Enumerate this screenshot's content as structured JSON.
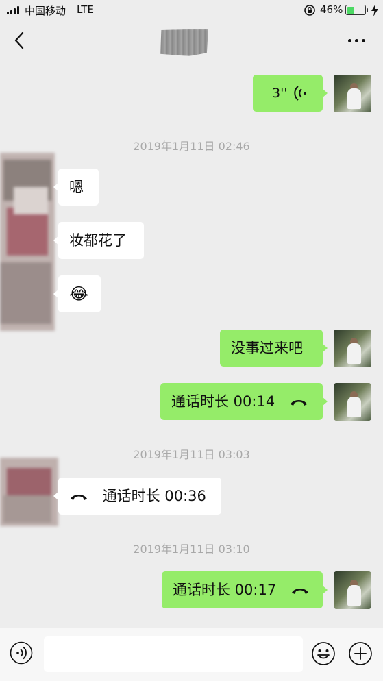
{
  "status_bar": {
    "carrier": "中国移动",
    "network": "LTE",
    "battery_percent": "46%",
    "battery_level": 0.46,
    "orientation_lock_icon": "orientation-lock-icon",
    "charging_icon": "charging-bolt-icon"
  },
  "nav": {
    "back_icon": "chevron-left-icon",
    "more_icon": "more-dots-icon"
  },
  "messages": [
    {
      "type": "voice",
      "direction": "out",
      "duration": "3''"
    },
    {
      "type": "timestamp",
      "text": "2019年1月11日 02:46"
    },
    {
      "type": "text",
      "direction": "in",
      "text": "嗯"
    },
    {
      "type": "text",
      "direction": "in",
      "text": "妆都花了"
    },
    {
      "type": "emoji",
      "direction": "in",
      "text": "😂"
    },
    {
      "type": "text",
      "direction": "out",
      "text": "没事过来吧"
    },
    {
      "type": "call",
      "direction": "out",
      "text": "通话时长 00:14"
    },
    {
      "type": "timestamp",
      "text": "2019年1月11日 03:03"
    },
    {
      "type": "call",
      "direction": "in",
      "text": "通话时长 00:36"
    },
    {
      "type": "timestamp",
      "text": "2019年1月11日 03:10"
    },
    {
      "type": "call",
      "direction": "out",
      "text": "通话时长 00:17"
    }
  ],
  "input_bar": {
    "placeholder": "",
    "voice_icon": "voice-input-icon",
    "emoji_icon": "emoji-icon",
    "plus_icon": "plus-circle-icon"
  },
  "colors": {
    "background": "#ededed",
    "outgoing_bubble": "#95ec69",
    "incoming_bubble": "#ffffff",
    "timestamp": "#a8a8a8",
    "battery_fill": "#4cd964"
  }
}
